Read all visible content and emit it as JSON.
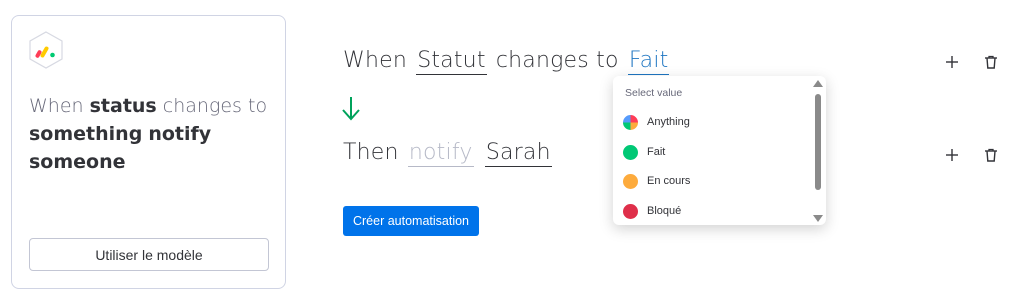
{
  "template_card": {
    "text_when": "When",
    "text_status": "status",
    "text_changes_to": "changes to",
    "text_something": "something",
    "text_notify": "notify",
    "text_someone": "someone",
    "use_button_label": "Utiliser le modèle"
  },
  "recipe": {
    "trigger": {
      "when": "When",
      "column": "Statut",
      "changes_to": "changes to",
      "value": "Fait"
    },
    "action": {
      "then": "Then",
      "verb_placeholder": "notify",
      "person": "Sarah"
    },
    "create_button_label": "Créer automatisation"
  },
  "dropdown": {
    "header": "Select value",
    "options": [
      {
        "label": "Anything",
        "color": "conic"
      },
      {
        "label": "Fait",
        "color": "#00c875"
      },
      {
        "label": "En cours",
        "color": "#fdab3d"
      },
      {
        "label": "Bloqué",
        "color": "#df2f4a"
      }
    ]
  },
  "icons": {
    "add": "plus-icon",
    "delete": "trash-icon",
    "arrow": "arrow-down-icon",
    "logo": "monday-logo-icon"
  },
  "colors": {
    "accent_blue": "#1f76c2",
    "primary_button": "#0073ea",
    "arrow_green": "#00a25b"
  }
}
